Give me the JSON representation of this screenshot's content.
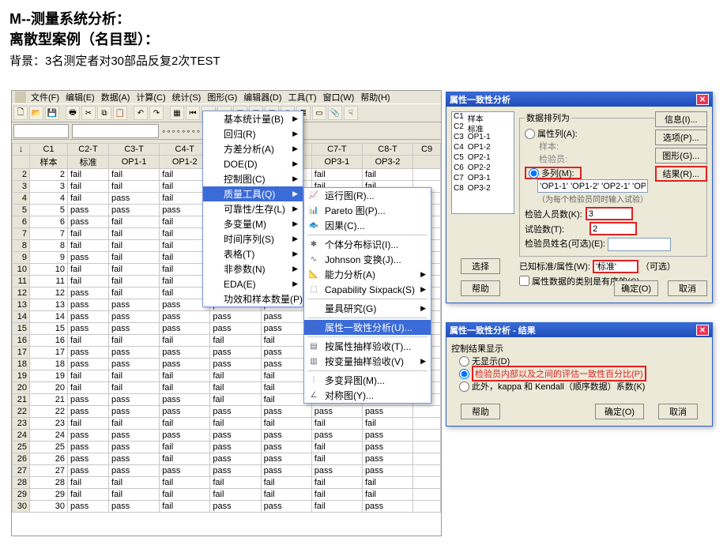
{
  "page": {
    "title": "M--测量系统分析：",
    "subtitle": "离散型案例（名目型）：",
    "background": "背景：3名测定者对30部品反复2次TEST"
  },
  "menubar": [
    "文件(F)",
    "编辑(E)",
    "数据(A)",
    "计算(C)",
    "统计(S)",
    "图形(G)",
    "编辑器(D)",
    "工具(T)",
    "窗口(W)",
    "帮助(H)"
  ],
  "toolbar_icons": [
    "new",
    "open",
    "save",
    "print",
    "cut",
    "copy",
    "paste",
    "undo",
    "redo",
    "grid",
    "prev",
    "next",
    "last",
    "sheet1",
    "sheet2",
    "sheet3",
    "info",
    "tree",
    "chart",
    "clip",
    "hand"
  ],
  "toolbar2_icons": [
    "ptr",
    "zoom",
    "pick",
    "run",
    "del",
    "find",
    "sel",
    "edit"
  ],
  "columns": {
    "codes": [
      "",
      "C1",
      "C2-T",
      "C3-T",
      "C4-T",
      "C5-T",
      "C6-T",
      "C7-T",
      "C8-T",
      "C9"
    ],
    "names": [
      "",
      "样本",
      "标准",
      "OP1-1",
      "OP1-2",
      "OP2-1",
      "OP2-2",
      "OP3-1",
      "OP3-2",
      ""
    ]
  },
  "data_rows": [
    [
      2,
      "fail",
      "fail",
      "fail",
      "fail",
      "fail",
      "fail",
      "fail",
      ""
    ],
    [
      3,
      "fail",
      "fail",
      "fail",
      "fail",
      "fail",
      "fail",
      "fail",
      ""
    ],
    [
      4,
      "fail",
      "pass",
      "fail",
      "fail",
      "fail",
      "fail",
      "fail",
      ""
    ],
    [
      5,
      "pass",
      "pass",
      "pass",
      "pass",
      "pass",
      "pass",
      "pass",
      ""
    ],
    [
      6,
      "pass",
      "fail",
      "fail",
      "fail",
      "fail",
      "fail",
      "fail",
      ""
    ],
    [
      7,
      "fail",
      "fail",
      "fail",
      "fail",
      "fail",
      "fail",
      "fail",
      ""
    ],
    [
      8,
      "fail",
      "fail",
      "fail",
      "fail",
      "fail",
      "fail",
      "fail",
      ""
    ],
    [
      9,
      "pass",
      "fail",
      "fail",
      "fail",
      "fail",
      "fail",
      "fail",
      ""
    ],
    [
      10,
      "fail",
      "fail",
      "fail",
      "fail",
      "fail",
      "fail",
      "fail",
      ""
    ],
    [
      11,
      "fail",
      "fail",
      "fail",
      "fail",
      "fail",
      "fail",
      "fail",
      ""
    ],
    [
      12,
      "pass",
      "fail",
      "fail",
      "fail",
      "fail",
      "fail",
      "fail",
      ""
    ],
    [
      13,
      "pass",
      "pass",
      "pass",
      "pass",
      "pass",
      "pass",
      "pass",
      ""
    ],
    [
      14,
      "pass",
      "pass",
      "pass",
      "pass",
      "pass",
      "pass",
      "pass",
      ""
    ],
    [
      15,
      "pass",
      "pass",
      "pass",
      "pass",
      "pass",
      "pass",
      "pass",
      ""
    ],
    [
      16,
      "fail",
      "fail",
      "fail",
      "fail",
      "fail",
      "fail",
      "fail",
      ""
    ],
    [
      17,
      "pass",
      "pass",
      "pass",
      "pass",
      "pass",
      "fail",
      "pass",
      ""
    ],
    [
      18,
      "pass",
      "pass",
      "pass",
      "pass",
      "pass",
      "pass",
      "pass",
      ""
    ],
    [
      19,
      "fail",
      "fail",
      "fail",
      "fail",
      "fail",
      "fail",
      "fail",
      ""
    ],
    [
      20,
      "fail",
      "fail",
      "fail",
      "fail",
      "fail",
      "fail",
      "fail",
      ""
    ],
    [
      21,
      "pass",
      "pass",
      "pass",
      "fail",
      "fail",
      "fail",
      "fail",
      ""
    ],
    [
      22,
      "pass",
      "pass",
      "pass",
      "pass",
      "pass",
      "pass",
      "pass",
      ""
    ],
    [
      23,
      "fail",
      "fail",
      "fail",
      "fail",
      "fail",
      "fail",
      "fail",
      ""
    ],
    [
      24,
      "pass",
      "pass",
      "pass",
      "pass",
      "pass",
      "pass",
      "pass",
      ""
    ],
    [
      25,
      "pass",
      "pass",
      "fail",
      "pass",
      "pass",
      "fail",
      "pass",
      ""
    ],
    [
      26,
      "pass",
      "pass",
      "fail",
      "pass",
      "pass",
      "fail",
      "pass",
      ""
    ],
    [
      27,
      "pass",
      "pass",
      "pass",
      "pass",
      "pass",
      "pass",
      "pass",
      ""
    ],
    [
      28,
      "fail",
      "fail",
      "fail",
      "fail",
      "fail",
      "fail",
      "fail",
      ""
    ],
    [
      29,
      "fail",
      "fail",
      "fail",
      "fail",
      "fail",
      "fail",
      "fail",
      ""
    ],
    [
      30,
      "pass",
      "pass",
      "fail",
      "pass",
      "pass",
      "fail",
      "pass",
      ""
    ]
  ],
  "stat_menu": [
    "基本统计量(B)",
    "回归(R)",
    "方差分析(A)",
    "DOE(D)",
    "控制图(C)",
    "质量工具(Q)",
    "可靠性/生存(L)",
    "多变量(M)",
    "时间序列(S)",
    "表格(T)",
    "非参数(N)",
    "EDA(E)",
    "功效和样本数量(P)..."
  ],
  "stat_menu_active_index": 5,
  "quality_submenu": [
    {
      "label": "运行图(R)...",
      "icon": "📈"
    },
    {
      "label": "Pareto 图(P)...",
      "icon": "📊"
    },
    {
      "label": "因果(C)...",
      "icon": "🐟"
    },
    {
      "sep": true
    },
    {
      "label": "个体分布标识(I)...",
      "icon": "✱"
    },
    {
      "label": "Johnson 变换(J)...",
      "icon": "∿"
    },
    {
      "label": "能力分析(A)",
      "icon": "📐",
      "sub": true
    },
    {
      "label": "Capability Sixpack(S)",
      "icon": "⬚",
      "sub": true
    },
    {
      "sep": true
    },
    {
      "label": "量具研究(G)",
      "icon": "",
      "sub": true
    },
    {
      "sep": true
    },
    {
      "label": "属性一致性分析(U)...",
      "icon": "✓",
      "active": true
    },
    {
      "sep": true
    },
    {
      "label": "按属性抽样验收(T)...",
      "icon": "▤"
    },
    {
      "label": "按变量抽样验收(V)",
      "icon": "▥",
      "sub": true
    },
    {
      "sep": true
    },
    {
      "label": "多变异图(M)...",
      "icon": "⫶"
    },
    {
      "label": "对称图(Y)...",
      "icon": "∠"
    }
  ],
  "dlg1": {
    "title": "属性一致性分析",
    "columns": [
      [
        "C1",
        "样本"
      ],
      [
        "C2",
        "标准"
      ],
      [
        "C3",
        "OP1-1"
      ],
      [
        "C4",
        "OP1-2"
      ],
      [
        "C5",
        "OP2-1"
      ],
      [
        "C6",
        "OP2-2"
      ],
      [
        "C7",
        "OP3-1"
      ],
      [
        "C8",
        "OP3-2"
      ]
    ],
    "group_label": "数据排列为",
    "radio_attr": "属性列(A):",
    "sample_label": "样本:",
    "inspector_label_disabled": "检验员:",
    "radio_multi": "多列(M):",
    "multi_value": "'OP1-1' 'OP1-2' 'OP2-1' 'OP2-2' 'OP3-1' 'OP3-2'",
    "hint": "（为每个检验员同时输入试验）",
    "inspectors_num_label": "检验人员数(K):",
    "inspectors_num_value": "3",
    "trials_label": "试验数(T):",
    "trials_value": "2",
    "inspectors_name_label": "检验员姓名(可选)(E):",
    "known_std_label": "已知标准/属性(W):",
    "known_std_value": "'标准'",
    "optional": "（可选）",
    "ordered_label": "属性数据的类别是有序的(C)",
    "btn_select": "选择",
    "btn_help": "帮助",
    "btn_info": "信息(I)...",
    "btn_options": "选项(P)...",
    "btn_graph": "图形(G)...",
    "btn_results": "结果(R)...",
    "btn_ok": "确定(O)",
    "btn_cancel": "取消"
  },
  "dlg2": {
    "title": "属性一致性分析 - 结果",
    "group_label": "控制结果显示",
    "radio1": "无显示(D)",
    "radio2": "检验员内部以及之间的评估一致性百分比(P)",
    "radio3": "此外，kappa 和 Kendall（顺序数据）系数(K)",
    "btn_help": "帮助",
    "btn_ok": "确定(O)",
    "btn_cancel": "取消"
  }
}
